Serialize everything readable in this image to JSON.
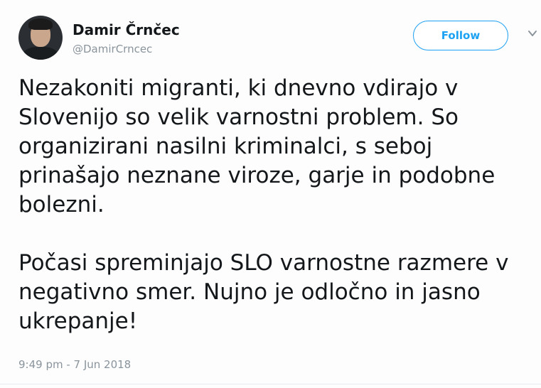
{
  "author": {
    "display_name": "Damir Črnčec",
    "handle": "@DamirCrncec"
  },
  "actions": {
    "follow_label": "Follow"
  },
  "tweet": {
    "lines_1": [
      "Nezakoniti migranti, ki dnevno vdirajo v",
      "Slovenijo so velik varnostni problem. So",
      "organizirani nasilni kriminalci, s seboj",
      "prinašajo neznane viroze, garje in podobne",
      "bolezni."
    ],
    "lines_2": [
      "Počasi spreminjajo SLO varnostne razmere v",
      "negativno smer. Nujno je odločno in jasno",
      "ukrepanje!"
    ],
    "timestamp": "9:49 pm - 7 Jun 2018"
  },
  "colors": {
    "accent": "#1da1f2",
    "text": "#14171a",
    "muted": "#8a949c"
  },
  "icons": {
    "menu": "chevron-down-icon"
  }
}
